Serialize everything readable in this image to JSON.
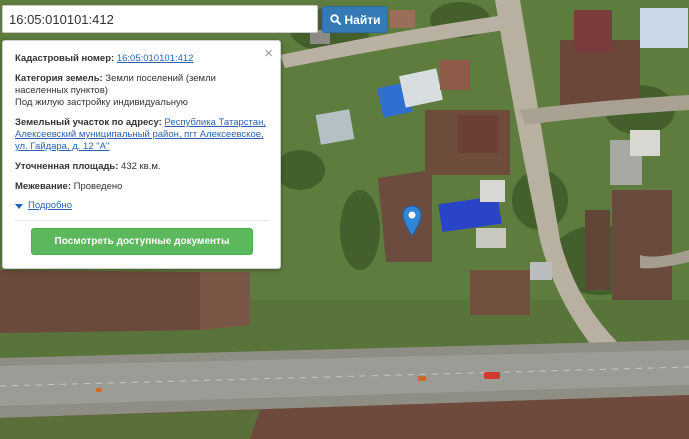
{
  "search": {
    "value": "16:05:010101:412",
    "button_label": "Найти",
    "button_icon": "search-icon"
  },
  "popup": {
    "close_glyph": "×",
    "cadastral": {
      "label": "Кадастровый номер:",
      "value": "16:05:010101:412"
    },
    "category": {
      "label": "Категория земель:",
      "value": "Земли поселений (земли населенных пунктов)",
      "purpose": "Под жилую застройку индивидуальную"
    },
    "address": {
      "label": "Земельный участок по адресу:",
      "value": "Республика Татарстан, Алексеевский муниципальный район, пгт Алексеевское, ул. Гайдара, д. 12 \"А\""
    },
    "area": {
      "label": "Уточненная площадь:",
      "value": "432 кв.м."
    },
    "survey": {
      "label": "Межевание:",
      "value": "Проведено"
    },
    "more_label": "Подробно",
    "docs_button_label": "Посмотреть доступные документы"
  },
  "map": {
    "type": "satellite",
    "marker_color": "#2f86d6"
  },
  "colors": {
    "search_button": "#337ab7",
    "docs_button": "#5cb85c",
    "link": "#2a64b2"
  }
}
